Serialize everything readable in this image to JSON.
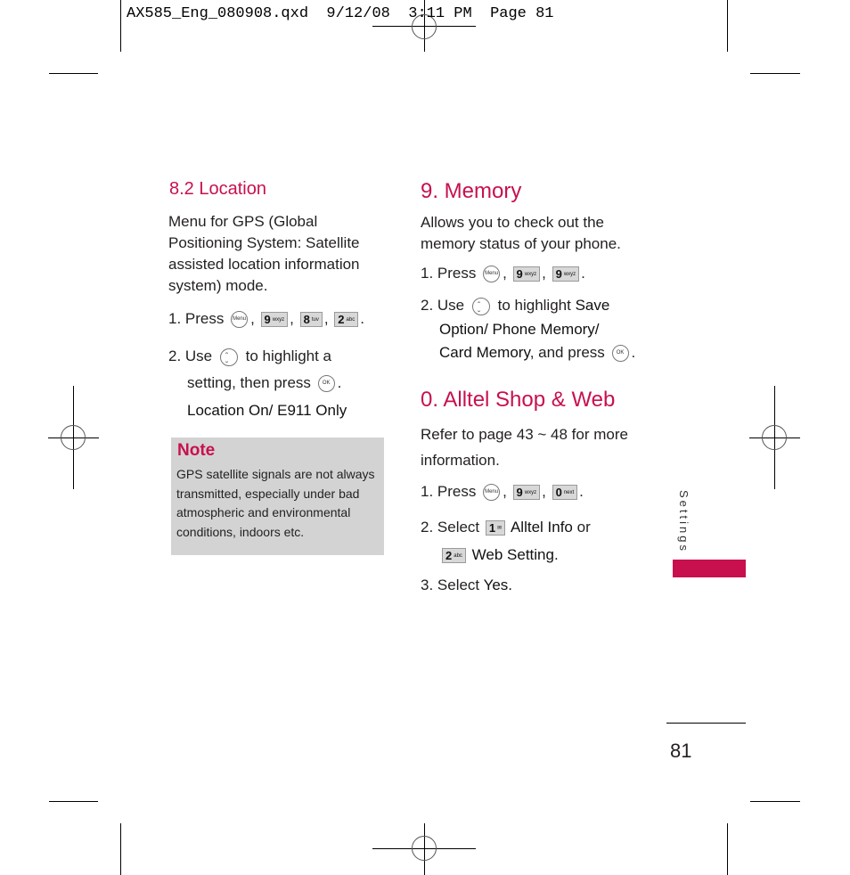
{
  "slug": {
    "text": "AX585_Eng_080908.qxd  9/12/08  3:11 PM  Page 81"
  },
  "left_column": {
    "section_title": "8.2 Location",
    "intro": "Menu for GPS (Global Positioning System: Satellite assisted location information system) mode.",
    "step1_prefix": "1. Press",
    "step1_keys": [
      {
        "type": "round",
        "label": "Menu"
      },
      {
        "type": "key",
        "digit": "9",
        "letters": "wxyz"
      },
      {
        "type": "key",
        "digit": "8",
        "letters": "tuv"
      },
      {
        "type": "key",
        "digit": "2",
        "letters": "abc"
      }
    ],
    "step2_prefix": "2. Use",
    "step2_mid": "to highlight a",
    "step2_line2": "setting, then press",
    "ok_label": "OK",
    "options": "Location On/ E911 Only",
    "note": {
      "title": "Note",
      "text": "GPS satellite signals are not always transmitted, especially under bad atmospheric and environmental conditions, indoors etc."
    }
  },
  "right_column": {
    "memory": {
      "title": "9. Memory",
      "intro": "Allows you to check out the memory status of your phone.",
      "step1_prefix": "1. Press",
      "step1_keys": [
        {
          "type": "round",
          "label": "Menu"
        },
        {
          "type": "key",
          "digit": "9",
          "letters": "wxyz"
        },
        {
          "type": "key",
          "digit": "9",
          "letters": "wxyz"
        }
      ],
      "step2_prefix": "2. Use",
      "step2_mid": "to highlight",
      "step2_bold1": "Save",
      "step2_bold2": "Option/ Phone Memory/",
      "step2_bold3": "Card Memory",
      "step2_tail": ", and press",
      "ok_label": "OK"
    },
    "shop": {
      "title": "0. Alltel Shop & Web",
      "intro_line1": "Refer to page 43 ~ 48 for more",
      "intro_line2": "information.",
      "step1_prefix": "1. Press",
      "step1_keys": [
        {
          "type": "round",
          "label": "Menu"
        },
        {
          "type": "key",
          "digit": "9",
          "letters": "wxyz"
        },
        {
          "type": "key",
          "digit": "0",
          "letters": "next"
        }
      ],
      "step2_prefix": "2. Select",
      "step2_key1": {
        "digit": "1",
        "letters": "✉"
      },
      "step2_opt1": "Alltel Info",
      "step2_or": "or",
      "step2_key2": {
        "digit": "2",
        "letters": "abc"
      },
      "step2_opt2": "Web Setting.",
      "step3_prefix": "3. Select",
      "step3_value": "Yes."
    }
  },
  "side_tab": {
    "label": "Settings",
    "color": "#c8104f"
  },
  "page_number": "81",
  "accent_color": "#c8104f"
}
